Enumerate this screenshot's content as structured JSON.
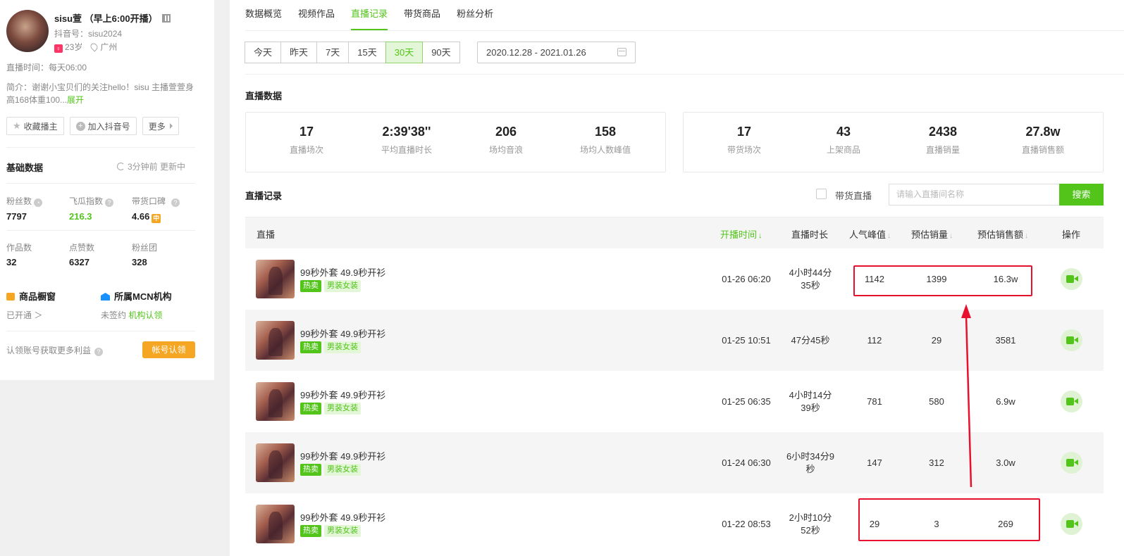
{
  "profile": {
    "name": "sisu萱 （早上6:00开播）",
    "douyin_id": "抖音号：sisu2024",
    "age": "23岁",
    "gender_glyph": "♀",
    "location": "广州",
    "live_time": "直播时间：每天06:00",
    "intro": "简介：谢谢小宝贝们的关注hello！sisu 主播萱萱身高168体重100...",
    "expand": "展开"
  },
  "actions": {
    "favorite": "收藏播主",
    "join": "加入抖音号",
    "more": "更多"
  },
  "basic": {
    "title": "基础数据",
    "refresh": "3分钟前  更新中",
    "stats": [
      {
        "label": "粉丝数",
        "value": "7797"
      },
      {
        "label": "飞瓜指数",
        "value": "216.3"
      },
      {
        "label": "带货口碑",
        "value": "4.66"
      },
      {
        "label": "作品数",
        "value": "32"
      },
      {
        "label": "点赞数",
        "value": "6327"
      },
      {
        "label": "粉丝团",
        "value": "328"
      }
    ],
    "zhong": "中"
  },
  "shop": {
    "title": "商品橱窗",
    "status": "已开通 ＞"
  },
  "mcn": {
    "title": "所属MCN机构",
    "status": "未签约",
    "link": "机构认领"
  },
  "claim": {
    "text": "认领账号获取更多利益",
    "button": "帐号认领"
  },
  "tabs": [
    "数据概览",
    "视频作品",
    "直播记录",
    "带货商品",
    "粉丝分析"
  ],
  "active_tab": "直播记录",
  "ranges": [
    "今天",
    "昨天",
    "7天",
    "15天",
    "30天",
    "90天"
  ],
  "active_range": "30天",
  "date_range": "2020.12.28 - 2021.01.26",
  "live_data": {
    "title": "直播数据",
    "left": [
      {
        "value": "17",
        "label": "直播场次"
      },
      {
        "value": "2:39'38''",
        "label": "平均直播时长"
      },
      {
        "value": "206",
        "label": "场均音浪"
      },
      {
        "value": "158",
        "label": "场均人数峰值"
      }
    ],
    "right": [
      {
        "value": "17",
        "label": "带货场次"
      },
      {
        "value": "43",
        "label": "上架商品"
      },
      {
        "value": "2438",
        "label": "直播销量"
      },
      {
        "value": "27.8w",
        "label": "直播销售额"
      }
    ]
  },
  "records": {
    "title": "直播记录",
    "filter_label": "带货直播",
    "search_placeholder": "请输入直播间名称",
    "search_button": "搜索",
    "columns": {
      "live": "直播",
      "start": "开播时间",
      "duration": "直播时长",
      "peak": "人气峰值",
      "sales": "预估销量",
      "revenue": "预估销售额",
      "op": "操作"
    },
    "sort_glyph": "↓",
    "rows": [
      {
        "title": "99秒外套 49.9秒开衫",
        "tag1": "热卖",
        "tag2": "男装女装",
        "start": "01-26 06:20",
        "duration": "4小时44分35秒",
        "peak": "1142",
        "sales": "1399",
        "revenue": "16.3w"
      },
      {
        "title": "99秒外套 49.9秒开衫",
        "tag1": "热卖",
        "tag2": "男装女装",
        "start": "01-25 10:51",
        "duration": "47分45秒",
        "peak": "112",
        "sales": "29",
        "revenue": "3581"
      },
      {
        "title": "99秒外套 49.9秒开衫",
        "tag1": "热卖",
        "tag2": "男装女装",
        "start": "01-25 06:35",
        "duration": "4小时14分39秒",
        "peak": "781",
        "sales": "580",
        "revenue": "6.9w"
      },
      {
        "title": "99秒外套 49.9秒开衫",
        "tag1": "热卖",
        "tag2": "男装女装",
        "start": "01-24 06:30",
        "duration": "6小时34分9秒",
        "peak": "147",
        "sales": "312",
        "revenue": "3.0w"
      },
      {
        "title": "99秒外套 49.9秒开衫",
        "tag1": "热卖",
        "tag2": "男装女装",
        "start": "01-22 08:53",
        "duration": "2小时10分52秒",
        "peak": "29",
        "sales": "3",
        "revenue": "269"
      }
    ]
  },
  "colors": {
    "accent": "#52c41a",
    "highlight": "#e8112d",
    "orange": "#f5a623"
  }
}
